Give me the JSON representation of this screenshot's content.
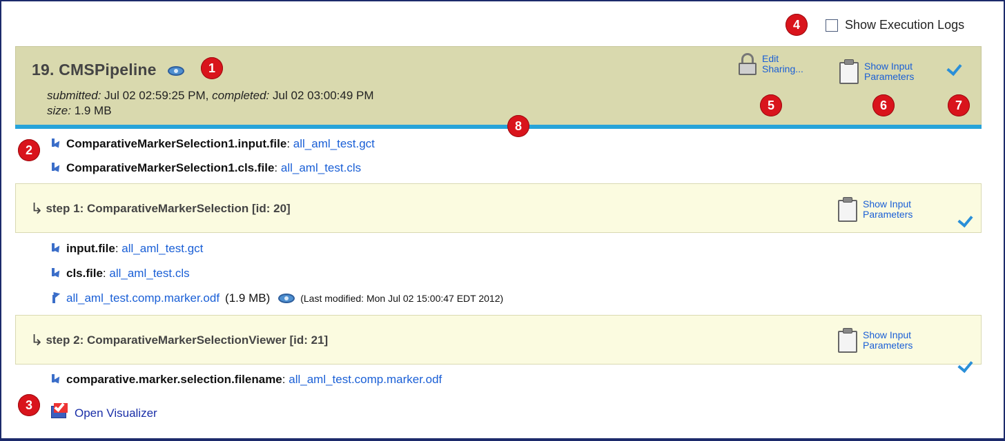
{
  "exec_logs": {
    "label": "Show Execution Logs"
  },
  "job": {
    "title": "19. CMSPipeline",
    "submitted_label": "submitted:",
    "submitted_value": "Jul 02 02:59:25 PM,",
    "completed_label": "completed:",
    "completed_value": "Jul 02 03:00:49 PM",
    "size_label": "size:",
    "size_value": "1.9 MB",
    "edit_sharing_line1": "Edit",
    "edit_sharing_line2": "Sharing...",
    "show_params_line1": "Show Input",
    "show_params_line2": "Parameters"
  },
  "job_inputs": [
    {
      "name": "ComparativeMarkerSelection1.input.file",
      "sep": ":",
      "value": "all_aml_test.gct"
    },
    {
      "name": "ComparativeMarkerSelection1.cls.file",
      "sep": ":",
      "value": "all_aml_test.cls"
    }
  ],
  "steps": [
    {
      "title": "step 1: ComparativeMarkerSelection [id: 20]",
      "show_params_line1": "Show Input",
      "show_params_line2": "Parameters",
      "inputs": [
        {
          "name": "input.file",
          "sep": ":",
          "value": "all_aml_test.gct"
        },
        {
          "name": "cls.file",
          "sep": ":",
          "value": "all_aml_test.cls"
        }
      ],
      "output": {
        "file": "all_aml_test.comp.marker.odf",
        "size": "(1.9 MB)",
        "modified": "(Last modified: Mon Jul 02 15:00:47 EDT 2012)"
      }
    },
    {
      "title": "step 2: ComparativeMarkerSelectionViewer [id: 21]",
      "show_params_line1": "Show Input",
      "show_params_line2": "Parameters",
      "inputs": [
        {
          "name": "comparative.marker.selection.filename",
          "sep": ":",
          "value": "all_aml_test.comp.marker.odf"
        }
      ]
    }
  ],
  "open_visualizer": {
    "label": "Open Visualizer"
  },
  "badges": [
    "1",
    "2",
    "3",
    "4",
    "5",
    "6",
    "7",
    "8"
  ],
  "colors": {
    "header_bg": "#d9d9ae",
    "step_bg": "#fbfbe0",
    "accent_bar": "#27a3d9",
    "link": "#1a5fd6",
    "badge": "#d9141c"
  }
}
